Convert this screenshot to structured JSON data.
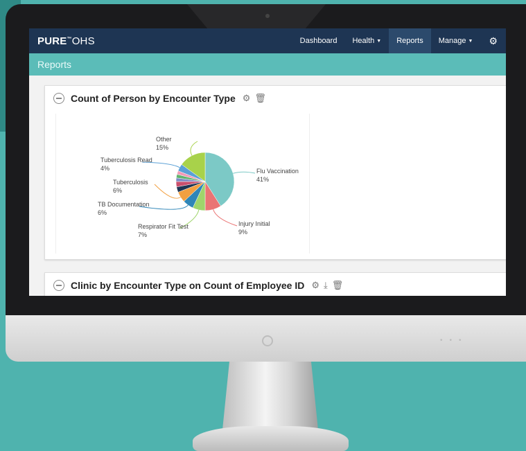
{
  "app": {
    "brand_bold": "PURE",
    "brand_mark": "™",
    "brand_thin": "OHS"
  },
  "nav": {
    "items": [
      {
        "label": "Dashboard",
        "dropdown": false,
        "active": false
      },
      {
        "label": "Health",
        "dropdown": true,
        "active": false
      },
      {
        "label": "Reports",
        "dropdown": false,
        "active": true
      },
      {
        "label": "Manage",
        "dropdown": true,
        "active": false
      }
    ],
    "settings_icon": "gear-icon"
  },
  "page": {
    "title": "Reports"
  },
  "panels": [
    {
      "title": "Count of Person by Encounter Type",
      "icons": [
        "gear-icon",
        "trash-icon"
      ]
    },
    {
      "title": "Clinic by Encounter Type on Count of Employee ID",
      "icons": [
        "gear-icon",
        "download-icon",
        "trash-icon"
      ]
    }
  ],
  "colors": {
    "nav_bg": "#1e3553",
    "subbar_bg": "#5bbcb8",
    "accent": "#5bbcb8"
  },
  "chart_data": {
    "type": "pie",
    "title": "Count of Person by Encounter Type",
    "slices": [
      {
        "label": "Flu Vaccination",
        "value": 41,
        "display": "41%",
        "color": "#7cc9c6"
      },
      {
        "label": "Injury Initial",
        "value": 9,
        "display": "9%",
        "color": "#ea7474"
      },
      {
        "label": "Respirator Fit Test",
        "value": 7,
        "display": "7%",
        "color": "#9fd56b"
      },
      {
        "label": "TB Documentation",
        "value": 6,
        "display": "6%",
        "color": "#2f86b8"
      },
      {
        "label": "Tuberculosis",
        "value": 6,
        "display": "6%",
        "color": "#f2a041"
      },
      {
        "label": "",
        "value": 3,
        "display": "",
        "color": "#1e3553"
      },
      {
        "label": "",
        "value": 3,
        "display": "",
        "color": "#c94f6d"
      },
      {
        "label": "",
        "value": 2,
        "display": "",
        "color": "#7c8cc4"
      },
      {
        "label": "",
        "value": 2,
        "display": "",
        "color": "#5fb36d"
      },
      {
        "label": "",
        "value": 2,
        "display": "",
        "color": "#f39ab6"
      },
      {
        "label": "Tuberculosis Read",
        "value": 4,
        "display": "4%",
        "color": "#5aa0d6"
      },
      {
        "label": "Other",
        "value": 15,
        "display": "15%",
        "color": "#a8d24a"
      }
    ]
  }
}
